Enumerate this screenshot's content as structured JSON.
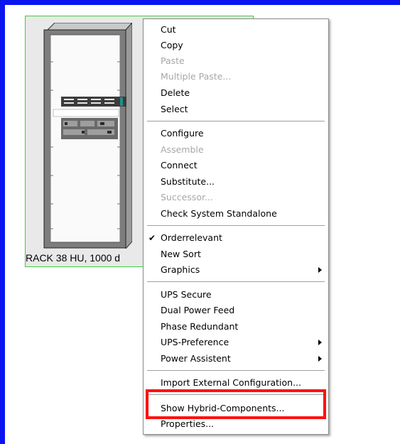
{
  "rack": {
    "caption": "RACK 38 HU, 1000 d"
  },
  "menu": {
    "items": [
      {
        "label": "Cut",
        "enabled": true
      },
      {
        "label": "Copy",
        "enabled": true
      },
      {
        "label": "Paste",
        "enabled": false
      },
      {
        "label": "Multiple Paste...",
        "enabled": false
      },
      {
        "label": "Delete",
        "enabled": true
      },
      {
        "label": "Select",
        "enabled": true
      },
      {
        "label": "Configure",
        "enabled": true
      },
      {
        "label": "Assemble",
        "enabled": false
      },
      {
        "label": "Connect",
        "enabled": true
      },
      {
        "label": "Substitute...",
        "enabled": true
      },
      {
        "label": "Successor...",
        "enabled": false
      },
      {
        "label": "Check System Standalone",
        "enabled": true
      },
      {
        "label": "Orderrelevant",
        "enabled": true,
        "checked": true
      },
      {
        "label": "New Sort",
        "enabled": true
      },
      {
        "label": "Graphics",
        "enabled": true,
        "submenu": true
      },
      {
        "label": "UPS Secure",
        "enabled": true
      },
      {
        "label": "Dual Power Feed",
        "enabled": true
      },
      {
        "label": "Phase Redundant",
        "enabled": true
      },
      {
        "label": "UPS-Preference",
        "enabled": true,
        "submenu": true
      },
      {
        "label": "Power Assistent",
        "enabled": true,
        "submenu": true
      },
      {
        "label": "Import External Configuration...",
        "enabled": true
      },
      {
        "label": "Show Hybrid-Components...",
        "enabled": true,
        "highlighted": true
      },
      {
        "label": "Properties...",
        "enabled": true
      }
    ]
  },
  "colors": {
    "border_blue": "#0a14f0",
    "selection_green": "#3ccf3c",
    "highlight_red": "#ff1010",
    "disabled_text": "#a7a6aa"
  }
}
